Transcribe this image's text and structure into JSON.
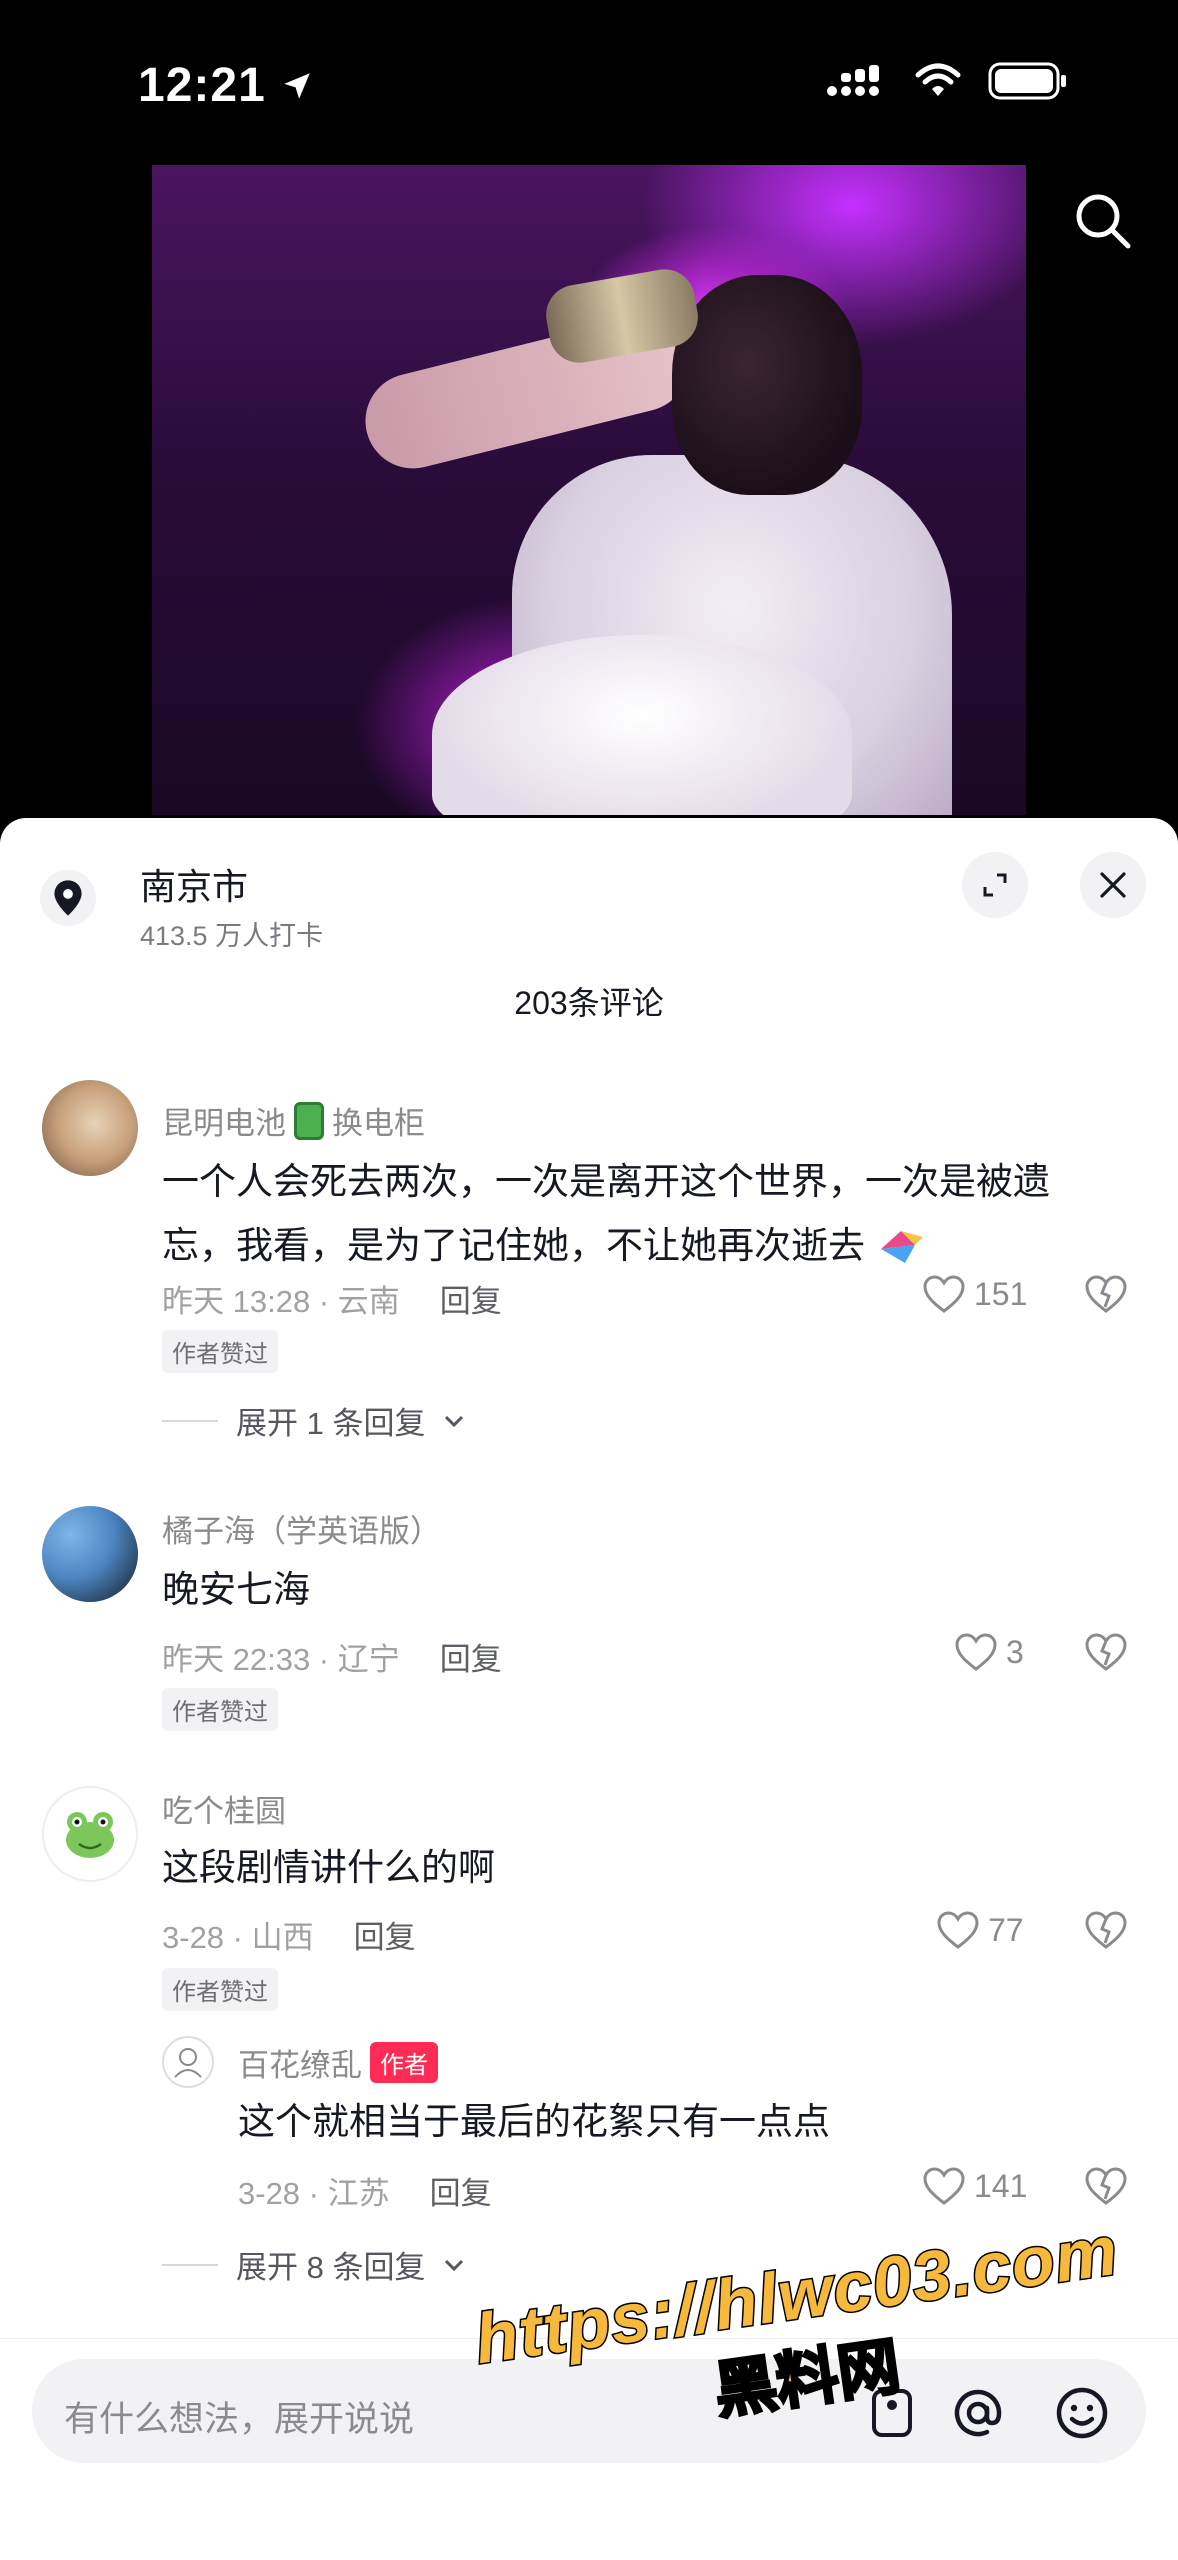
{
  "status_bar": {
    "time": "12:21"
  },
  "location": {
    "title": "南京市",
    "subtitle": "413.5 万人打卡"
  },
  "comments_header": {
    "count_label": "203条评论"
  },
  "comments": [
    {
      "user": "昆明电池",
      "user_suffix": "换电柜",
      "text": "一个人会死去两次，一次是离开这个世界，一次是被遗忘，我看，是为了记住她，不让她再次逝去",
      "meta": "昨天 13:28 · 云南",
      "reply_label": "回复",
      "likes": "151",
      "badge": "作者赞过",
      "expand_label": "展开 1 条回复"
    },
    {
      "user": "橘子海（学英语版）",
      "text": "晚安七海",
      "meta": "昨天 22:33 · 辽宁",
      "reply_label": "回复",
      "likes": "3",
      "badge": "作者赞过"
    },
    {
      "user": "吃个桂圆",
      "text": "这段剧情讲什么的啊",
      "meta": "3-28 · 山西",
      "reply_label": "回复",
      "likes": "77",
      "badge": "作者赞过",
      "reply": {
        "user": "百花缭乱",
        "author_tag": "作者",
        "text": "这个就相当于最后的花絮只有一点点",
        "meta": "3-28 · 江苏",
        "reply_label": "回复",
        "likes": "141"
      },
      "expand_label": "展开 8 条回复"
    }
  ],
  "input": {
    "placeholder": "有什么想法，展开说说"
  },
  "watermark": {
    "url": "https://hlwc03.com",
    "name": "黑料网"
  },
  "colors": {
    "accent": "#fe2c55",
    "sheet_bg": "#ffffff",
    "muted": "#8a8b91"
  }
}
